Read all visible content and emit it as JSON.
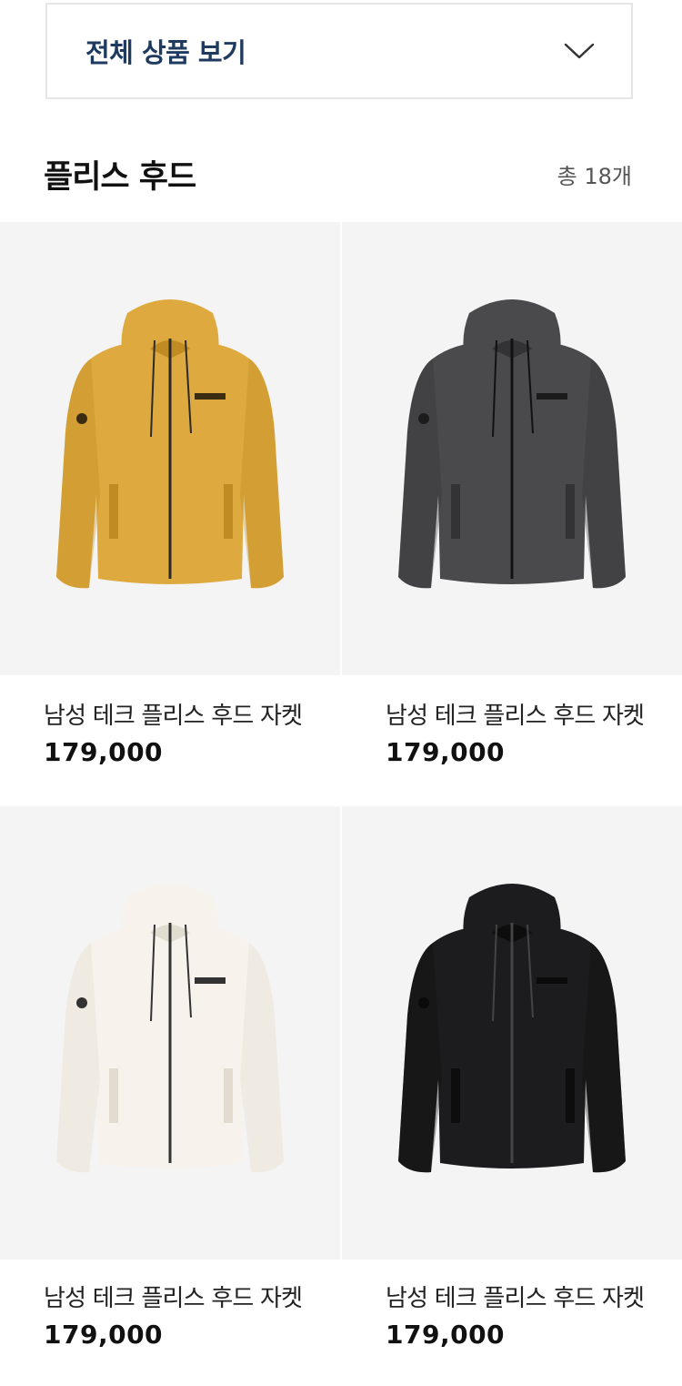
{
  "category_dropdown": {
    "label": "전체 상품 보기",
    "icon": "chevron-down-icon"
  },
  "section": {
    "title": "플리스 후드",
    "count": "총 18개"
  },
  "products": [
    {
      "name": "남성 테크 플리스 후드 자켓",
      "price": "179,000",
      "color": "#deaa3f",
      "shade": "#c08b22",
      "zip": "#2b2b2b",
      "logo_bg": "#3a2c10"
    },
    {
      "name": "남성 테크 플리스 후드 자켓",
      "price": "179,000",
      "color": "#4a4a4d",
      "shade": "#333336",
      "zip": "#111111",
      "logo_bg": "#1c1c1c"
    },
    {
      "name": "남성 테크 플리스 후드 자켓",
      "price": "179,000",
      "color": "#f7f3ec",
      "shade": "#e2dcd0",
      "zip": "#333333",
      "logo_bg": "#333333"
    },
    {
      "name": "남성 테크 플리스 후드 자켓",
      "price": "179,000",
      "color": "#1c1c1e",
      "shade": "#0d0d0e",
      "zip": "#444444",
      "logo_bg": "#0a0a0a"
    }
  ]
}
